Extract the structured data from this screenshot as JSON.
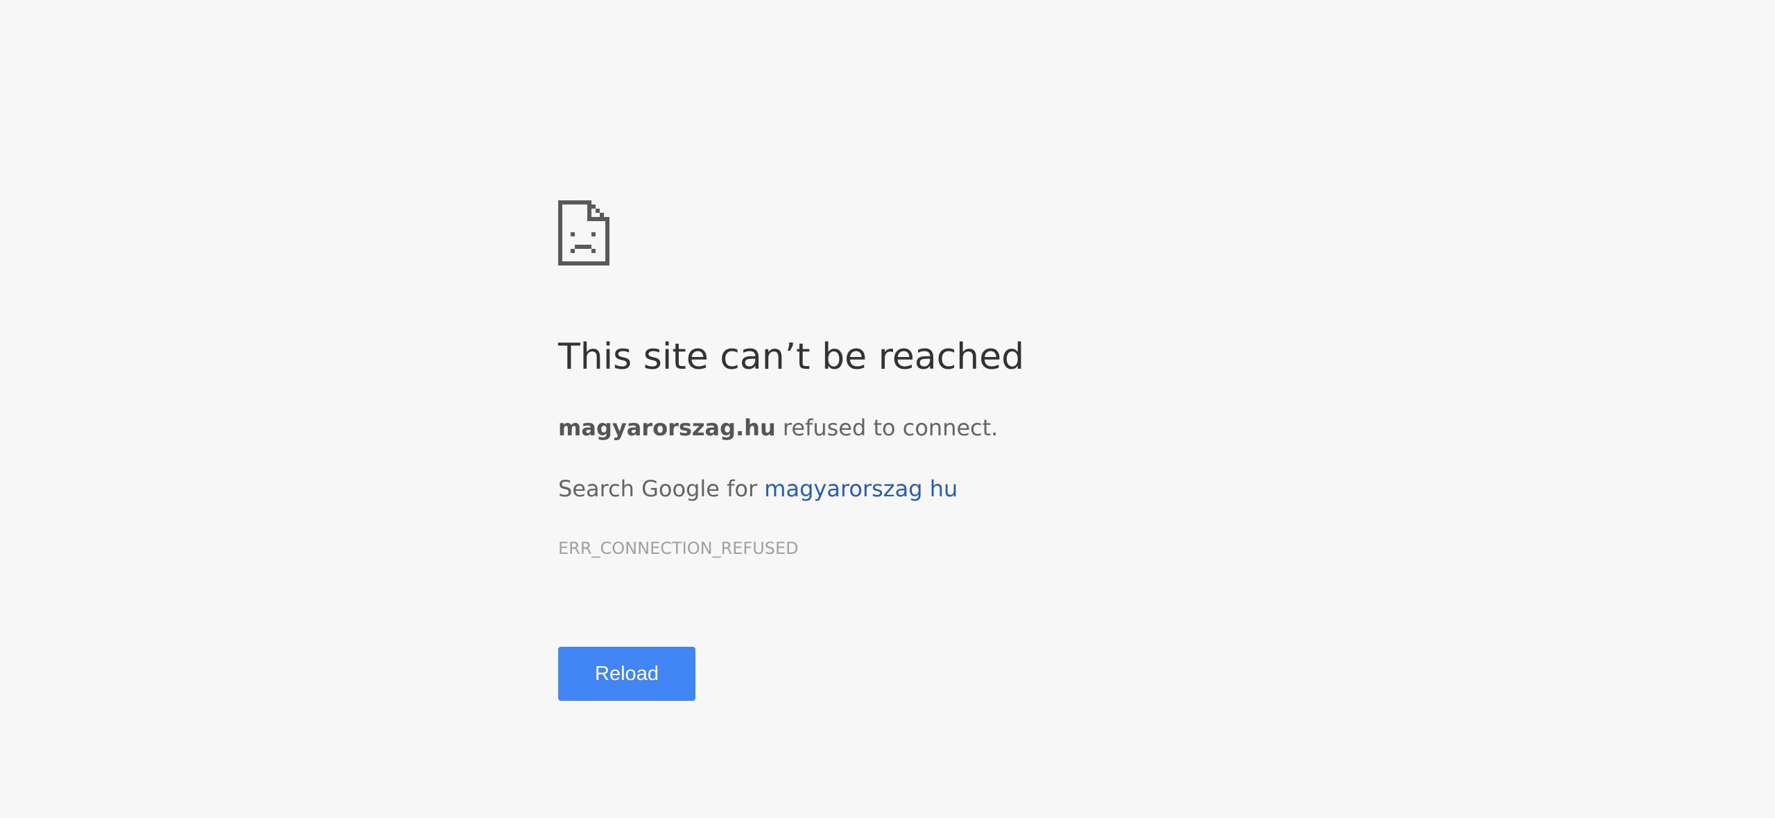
{
  "error": {
    "icon": "sad-page-icon",
    "heading": "This site can’t be reached",
    "host": "magyarorszag.hu",
    "host_message": " refused to connect.",
    "suggestion_prefix": "Search Google for ",
    "suggestion_link": "magyarorszag hu",
    "error_code": "ERR_CONNECTION_REFUSED",
    "reload_label": "Reload"
  },
  "colors": {
    "background": "#f7f7f7",
    "button": "#4285f4",
    "link": "#2a5db0"
  }
}
